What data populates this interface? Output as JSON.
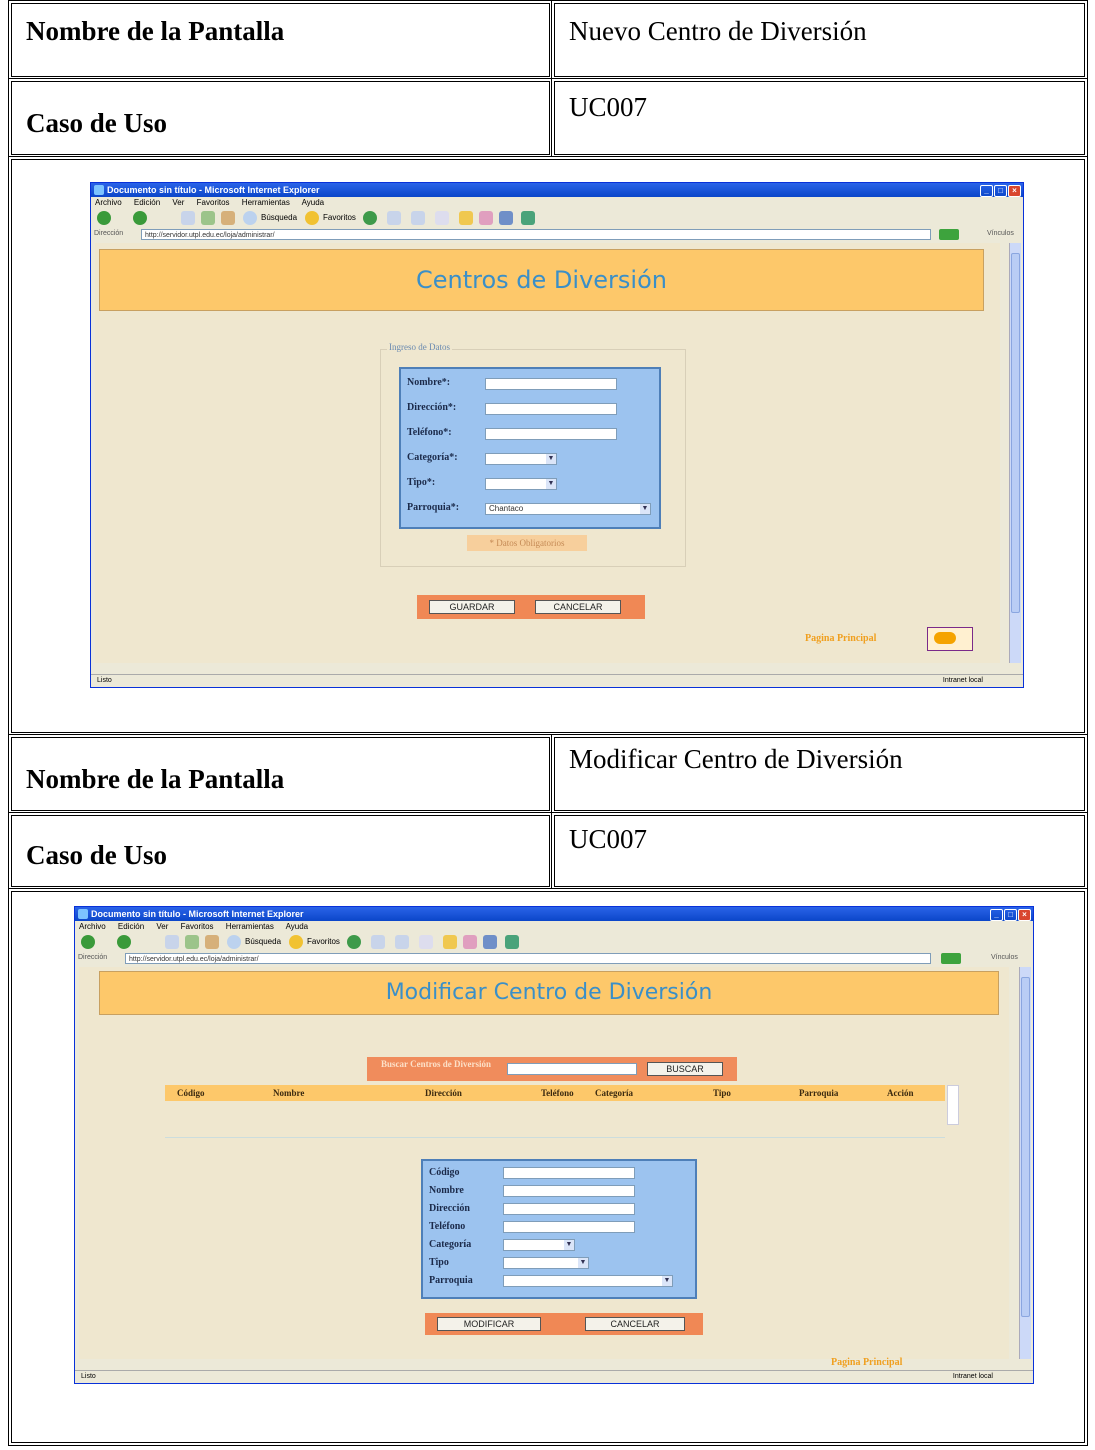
{
  "sections": [
    {
      "name_label": "Nombre de la Pantalla",
      "name_value": "Nuevo Centro de Diversión",
      "use_case_label": "Caso de Uso",
      "use_case_value": "UC007"
    },
    {
      "name_label": "Nombre de la Pantalla",
      "name_value": "Modificar Centro de Diversión",
      "use_case_label": "Caso de Uso",
      "use_case_value": "UC007"
    }
  ],
  "browser": {
    "title": "Documento sin título - Microsoft Internet Explorer",
    "menu": [
      "Archivo",
      "Edición",
      "Ver",
      "Favoritos",
      "Herramientas",
      "Ayuda"
    ],
    "search_label": "Búsqueda",
    "favorites_label": "Favoritos",
    "address_label": "Dirección",
    "address1": "http://servidor.utpl.edu.ec/loja/administrar/",
    "address2": "http://servidor.utpl.edu.ec/loja/administrar/",
    "links_label": "Vínculos",
    "status_left": "Listo",
    "status_right": "Intranet local"
  },
  "screen1": {
    "banner": "Centros de Diversión",
    "legend": "Ingreso de Datos",
    "fields": [
      "Nombre*:",
      "Dirección*:",
      "Teléfono*:",
      "Categoría*:",
      "Tipo*:",
      "Parroquia*:"
    ],
    "parroquia_value": "Chantaco",
    "obligatorios": "* Datos Obligatorios",
    "save_button": "GUARDAR",
    "cancel_button": "CANCELAR",
    "main_page": "Pagina Principal"
  },
  "screen2": {
    "banner": "Modificar Centro de Diversión",
    "search_label": "Buscar Centros de Diversión",
    "search_button": "BUSCAR",
    "columns": [
      "Código",
      "Nombre",
      "Dirección",
      "Teléfono",
      "Categoría",
      "Tipo",
      "Parroquia",
      "Acción"
    ],
    "fields": [
      "Código",
      "Nombre",
      "Dirección",
      "Teléfono",
      "Categoría",
      "Tipo",
      "Parroquia"
    ],
    "modify_button": "MODIFICAR",
    "cancel_button": "CANCELAR",
    "main_page": "Pagina Principal"
  }
}
